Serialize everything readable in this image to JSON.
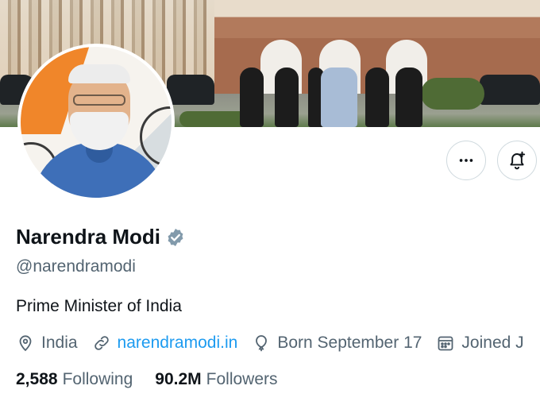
{
  "profile": {
    "name": "Narendra Modi",
    "handle": "@narendramodi",
    "bio": "Prime Minister of India",
    "location": "India",
    "website": "narendramodi.in",
    "birthday": "Born September 17",
    "joined": "Joined J"
  },
  "stats": {
    "following_count": "2,588",
    "following_label": "Following",
    "followers_count": "90.2M",
    "followers_label": "Followers"
  },
  "actions": {
    "more_icon": "ellipsis-icon",
    "notify_icon": "bell-plus-icon"
  },
  "colors": {
    "link": "#1d9bf0",
    "verified": "#829aab",
    "secondary_text": "#536471"
  }
}
